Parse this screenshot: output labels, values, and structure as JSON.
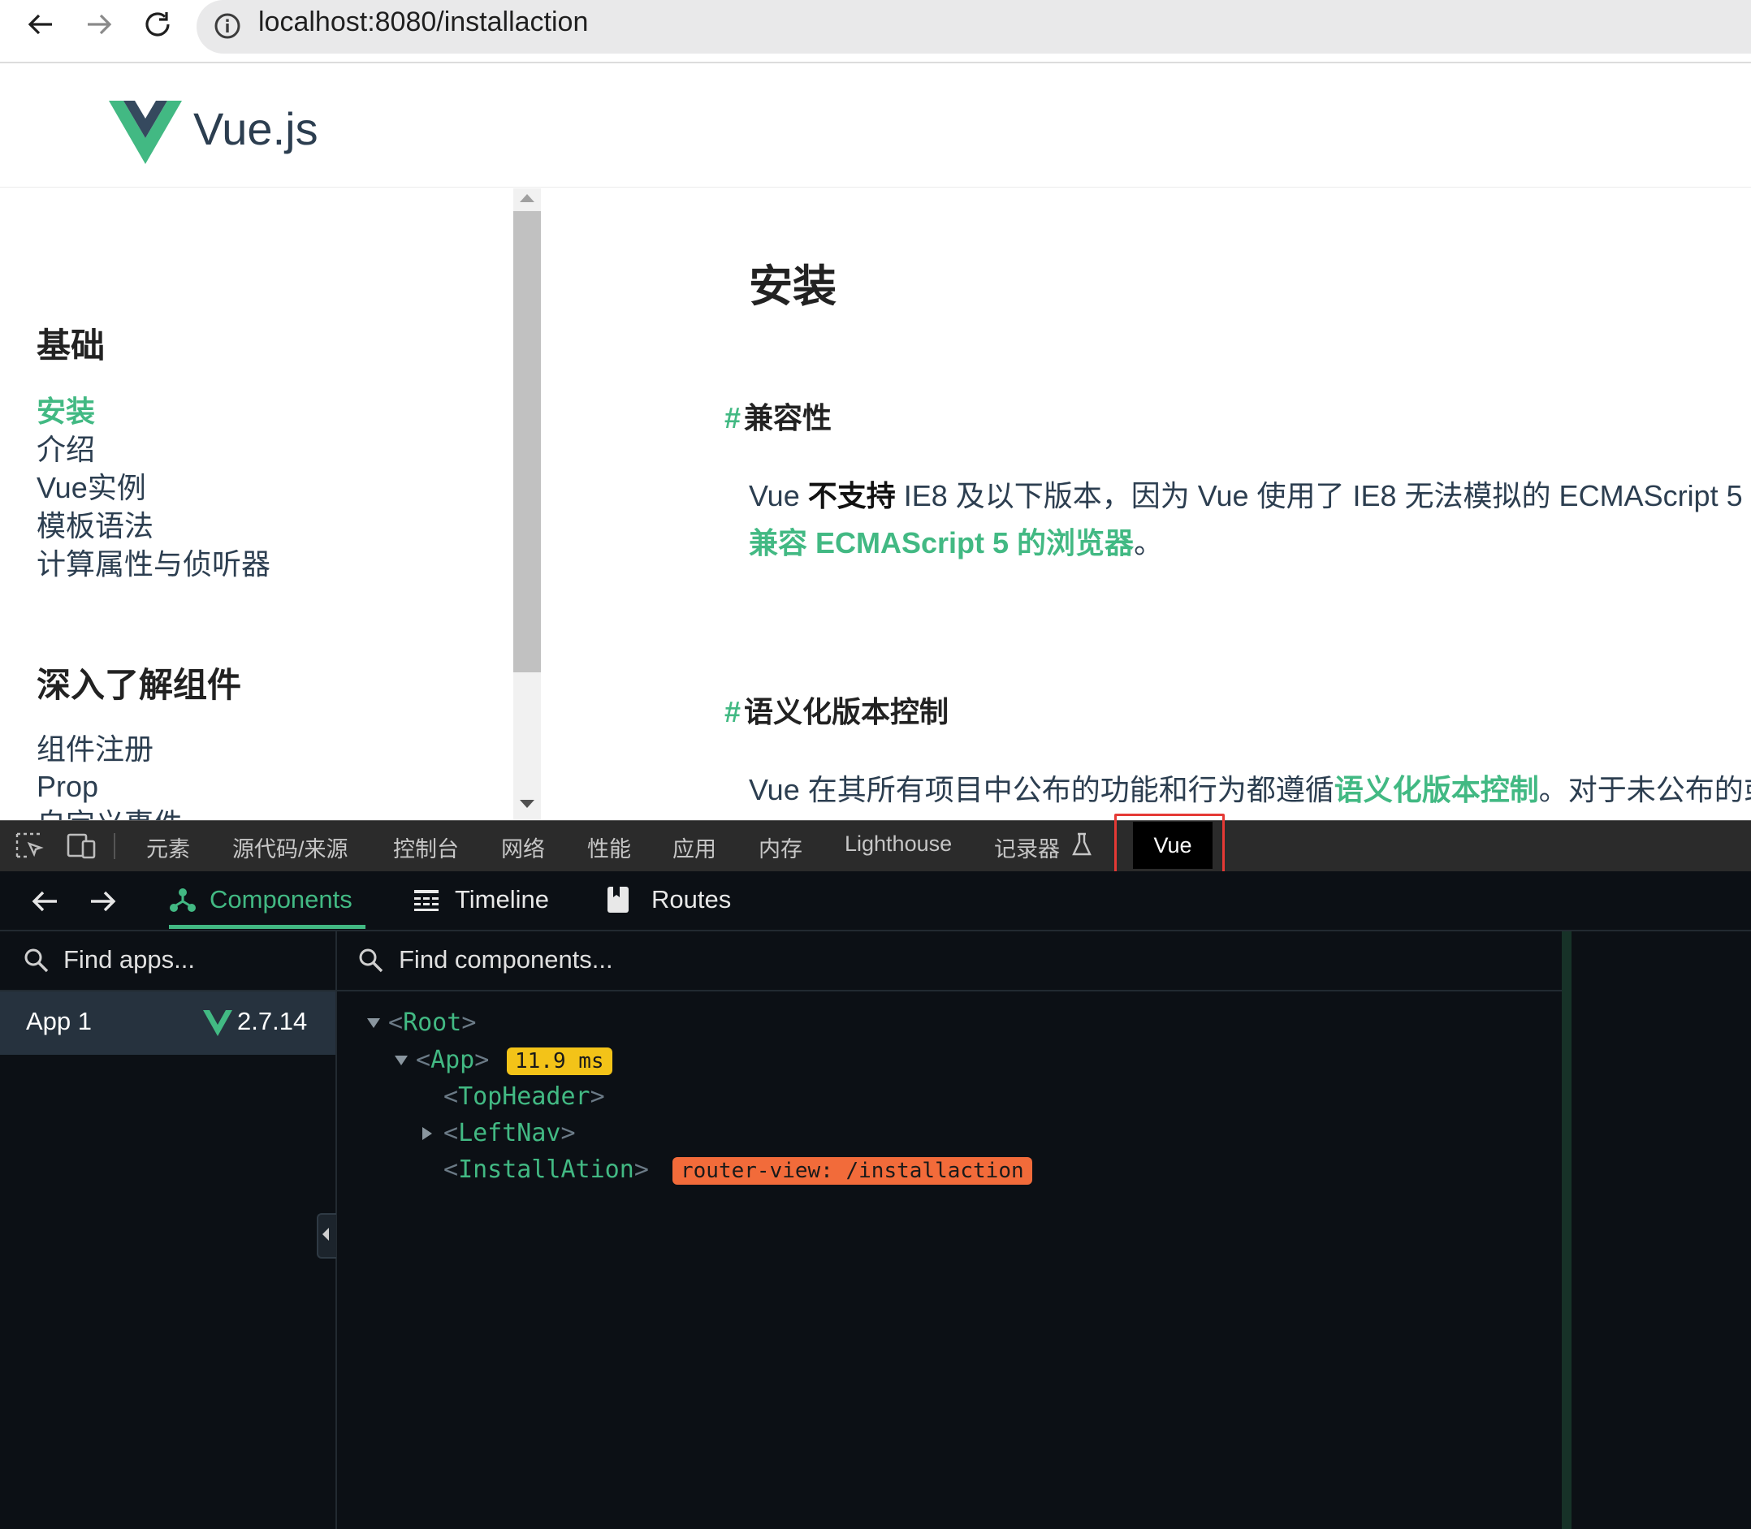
{
  "browser": {
    "url": "localhost:8080/installaction",
    "back_icon": "arrow-left-icon",
    "forward_icon": "arrow-right-icon",
    "reload_icon": "reload-icon",
    "info_icon": "info-icon"
  },
  "site": {
    "brand": "Vue.js",
    "logo_colors": {
      "outer": "#42b983",
      "inner": "#35495e"
    }
  },
  "leftnav": {
    "sections": [
      {
        "title": "基础",
        "items": [
          {
            "label": "安装",
            "active": true
          },
          {
            "label": "介绍"
          },
          {
            "label": "Vue实例"
          },
          {
            "label": "模板语法"
          },
          {
            "label": "计算属性与侦听器"
          }
        ]
      },
      {
        "title": "深入了解组件",
        "items": [
          {
            "label": "组件注册"
          },
          {
            "label": "Prop"
          },
          {
            "label": "自定义事件"
          }
        ]
      }
    ]
  },
  "content": {
    "title": "安装",
    "sections": [
      {
        "hash": "#",
        "heading": "兼容性",
        "text_before": "Vue ",
        "bold": "不支持",
        "text_after": " IE8 及以下版本，因为 Vue 使用了 IE8 无法模拟的 ECMAScript 5",
        "link": "兼容 ECMAScript 5 的浏览器",
        "tail": "。"
      },
      {
        "hash": "#",
        "heading": "语义化版本控制",
        "text_before": "Vue 在其所有项目中公布的功能和行为都遵循",
        "link": "语义化版本控制",
        "tail": "。对于未公布的或"
      }
    ]
  },
  "devtools_tabs": {
    "inspect_icon": "inspect-element-icon",
    "device_icon": "device-toggle-icon",
    "tabs": [
      "元素",
      "源代码/来源",
      "控制台",
      "网络",
      "性能",
      "应用",
      "内存",
      "Lighthouse",
      "记录器"
    ],
    "recorder_icon": "flask-icon",
    "active": "Vue"
  },
  "vue_devtools": {
    "nav_back_icon": "arrow-left-icon",
    "nav_forward_icon": "arrow-right-icon",
    "tabs": [
      {
        "label": "Components",
        "icon": "components-icon",
        "active": true
      },
      {
        "label": "Timeline",
        "icon": "timeline-icon"
      },
      {
        "label": "Routes",
        "icon": "routes-icon"
      }
    ],
    "apps_search_placeholder": "Find apps...",
    "components_search_placeholder": "Find components...",
    "app": {
      "name": "App 1",
      "version": "2.7.14"
    },
    "tree": [
      {
        "name": "Root",
        "expanded": true
      },
      {
        "name": "App",
        "expanded": true,
        "badge": "11.9 ms"
      },
      {
        "name": "TopHeader"
      },
      {
        "name": "LeftNav",
        "collapsed": true
      },
      {
        "name": "InstallAtion",
        "badge": "router-view: /installaction"
      }
    ],
    "accent": "#42b983"
  }
}
